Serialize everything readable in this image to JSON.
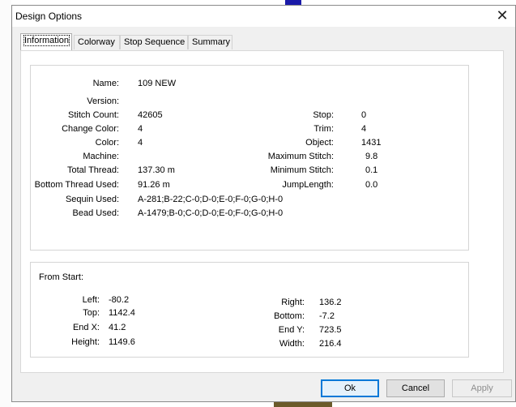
{
  "dialog": {
    "title": "Design Options",
    "close_glyph": "✕",
    "tabs": [
      "Information",
      "Colorway",
      "Stop Sequence",
      "Summary"
    ]
  },
  "info": {
    "left": [
      {
        "label": "Name:",
        "value": "109 NEW"
      },
      {
        "label": "Version:",
        "value": ""
      },
      {
        "label": "Stitch Count:",
        "value": "42605"
      },
      {
        "label": "Change Color:",
        "value": "4"
      },
      {
        "label": "Color:",
        "value": "4"
      },
      {
        "label": "Machine:",
        "value": ""
      },
      {
        "label": "Total Thread:",
        "value": "137.30 m"
      },
      {
        "label": "Bottom Thread Used:",
        "value": "91.26 m"
      },
      {
        "label": "Sequin Used:",
        "value": "A-281;B-22;C-0;D-0;E-0;F-0;G-0;H-0"
      },
      {
        "label": "Bead Used:",
        "value": "A-1479;B-0;C-0;D-0;E-0;F-0;G-0;H-0"
      }
    ],
    "right": [
      {
        "label": "Stop:",
        "value": "0"
      },
      {
        "label": "Trim:",
        "value": "4"
      },
      {
        "label": "Object:",
        "value": "1431"
      },
      {
        "label": "Maximum Stitch:",
        "value": "9.8"
      },
      {
        "label": "Minimum Stitch:",
        "value": "0.1"
      },
      {
        "label": "JumpLength:",
        "value": "0.0"
      }
    ]
  },
  "from_start": {
    "heading": "From Start:",
    "left": [
      {
        "label": "Left:",
        "value": "-80.2"
      },
      {
        "label": "Top:",
        "value": "1142.4"
      },
      {
        "label": "End X:",
        "value": "41.2"
      },
      {
        "label": "Height:",
        "value": "1149.6"
      }
    ],
    "right": [
      {
        "label": "Right:",
        "value": "136.2"
      },
      {
        "label": "Bottom:",
        "value": "-7.2"
      },
      {
        "label": "End Y:",
        "value": "723.5"
      },
      {
        "label": "Width:",
        "value": "216.4"
      }
    ]
  },
  "buttons": {
    "ok": "Ok",
    "cancel": "Cancel",
    "apply": "Apply"
  }
}
